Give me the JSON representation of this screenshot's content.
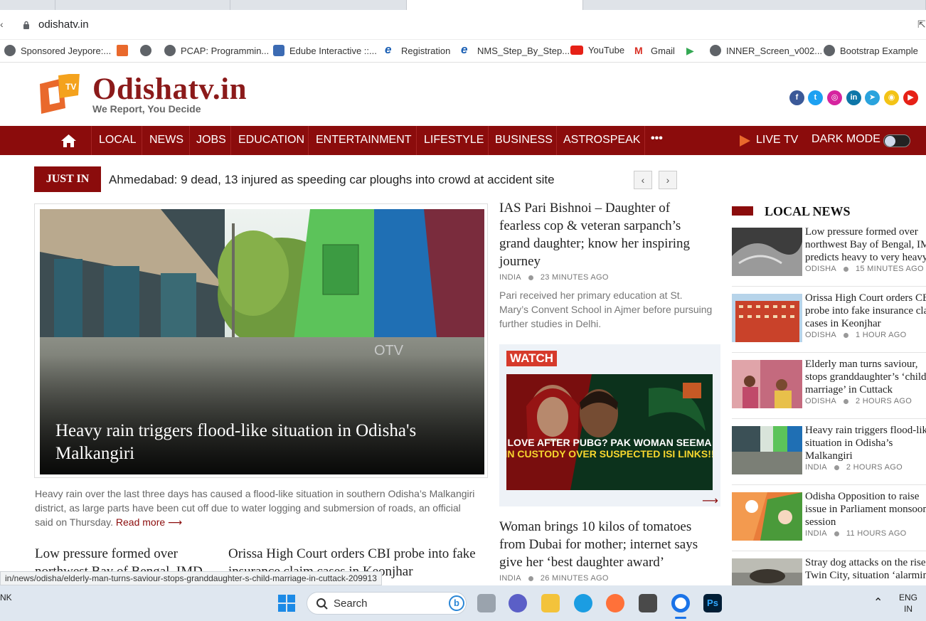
{
  "browser": {
    "url": "odishatv.in",
    "bookmarks": [
      {
        "label": "Sponsored Jeypore:...",
        "icon": "globe-icon"
      },
      {
        "label": "",
        "icon": "grid-icon"
      },
      {
        "label": "",
        "icon": "globe-icon"
      },
      {
        "label": "PCAP: Programmin...",
        "icon": "globe-icon"
      },
      {
        "label": "Edube Interactive ::...",
        "icon": "edube-icon"
      },
      {
        "label": "Registration",
        "icon": "edge-icon"
      },
      {
        "label": "NMS_Step_By_Step...",
        "icon": "edge-icon"
      },
      {
        "label": "YouTube",
        "icon": "youtube-icon"
      },
      {
        "label": "Gmail",
        "icon": "gmail-icon"
      },
      {
        "label": "",
        "icon": "play-store-icon"
      },
      {
        "label": "INNER_Screen_v002...",
        "icon": "globe-icon"
      },
      {
        "label": "Bootstrap Example",
        "icon": "globe-icon"
      }
    ],
    "status_url": "in/news/odisha/elderly-man-turns-saviour-stops-granddaughter-s-child-marriage-in-cuttack-209913"
  },
  "site": {
    "logo_text": "Odishatv.in",
    "tagline": "We Report, You Decide",
    "social": [
      {
        "name": "facebook-icon",
        "glyph": "f",
        "color": "#3b5998"
      },
      {
        "name": "twitter-icon",
        "glyph": "t",
        "color": "#1da1f2"
      },
      {
        "name": "instagram-icon",
        "glyph": "◎",
        "color": "#d6249f"
      },
      {
        "name": "linkedin-icon",
        "glyph": "in",
        "color": "#0e76a8"
      },
      {
        "name": "telegram-icon",
        "glyph": "➤",
        "color": "#2aa3dd"
      },
      {
        "name": "koo-icon",
        "glyph": "◉",
        "color": "#f3c316"
      },
      {
        "name": "youtube-social-icon",
        "glyph": "▶",
        "color": "#e62117"
      }
    ]
  },
  "nav": {
    "items": [
      "LOCAL",
      "NEWS",
      "JOBS",
      "EDUCATION",
      "ENTERTAINMENT",
      "LIFESTYLE",
      "BUSINESS",
      "ASTROSPEAK"
    ],
    "more": "•••",
    "live_tv": "LIVE TV",
    "dark_mode": "DARK MODE"
  },
  "ticker": {
    "label": "JUST IN",
    "text": "Ahmedabad: 9 dead, 13 injured as speeding car ploughs into crowd at accident site"
  },
  "hero": {
    "title": "Heavy rain triggers flood-like situation in Odisha's Malkangiri",
    "desc": "Heavy rain over the last three days has caused a flood-like situation in southern Odisha’s Malkangiri district, as large parts have been cut off due to water logging and submersion of roads, an official said on Thursday.",
    "read_more": "Read more",
    "watermark": "OTV"
  },
  "below_hero": [
    {
      "title": "Low pressure formed over northwest Bay of Bengal, IMD"
    },
    {
      "title": "Orissa High Court orders CBI probe into fake insurance claim cases in Keonjhar"
    }
  ],
  "middle": {
    "top_story": {
      "title": "IAS Pari Bishnoi – Daughter of fearless cop & veteran sarpanch’s grand daughter; know her inspiring journey",
      "category": "INDIA",
      "time": "23 MINUTES AGO",
      "desc": "Pari received her primary education at St. Mary’s Convent School in Ajmer before pursuing further studies in Delhi."
    },
    "watch": {
      "label": "WATCH",
      "caption_line1": "LOVE AFTER PUBG? PAK WOMAN SEEMA",
      "caption_line2": "IN CUSTODY OVER SUSPECTED ISI LINKS!!"
    },
    "second_story": {
      "title": "Woman brings 10 kilos of tomatoes from Dubai for mother; internet says give her ‘best daughter award’",
      "category": "INDIA",
      "time": "26 MINUTES AGO"
    }
  },
  "local_news": {
    "heading": "LOCAL NEWS",
    "items": [
      {
        "title": "Low pressure formed over northwest Bay of Bengal, IMD predicts heavy to very heavy",
        "category": "ODISHA",
        "time": "15 MINUTES AGO"
      },
      {
        "title": "Orissa High Court orders CBI probe into fake insurance claim cases in Keonjhar",
        "category": "ODISHA",
        "time": "1 HOUR AGO"
      },
      {
        "title": "Elderly man turns saviour, stops granddaughter’s ‘child marriage’ in Cuttack",
        "category": "ODISHA",
        "time": "2 HOURS AGO"
      },
      {
        "title": "Heavy rain triggers flood-like situation in Odisha’s Malkangiri",
        "category": "INDIA",
        "time": "2 HOURS AGO"
      },
      {
        "title": "Odisha Opposition to raise issue in Parliament monsoon session",
        "category": "INDIA",
        "time": "11 HOURS AGO"
      },
      {
        "title": "Stray dog attacks on the rise in Twin City, situation ‘alarming’",
        "category": "",
        "time": ""
      }
    ]
  },
  "taskbar": {
    "left_text": "NK",
    "search_placeholder": "Search",
    "lang_line1": "ENG",
    "lang_line2": "IN"
  }
}
